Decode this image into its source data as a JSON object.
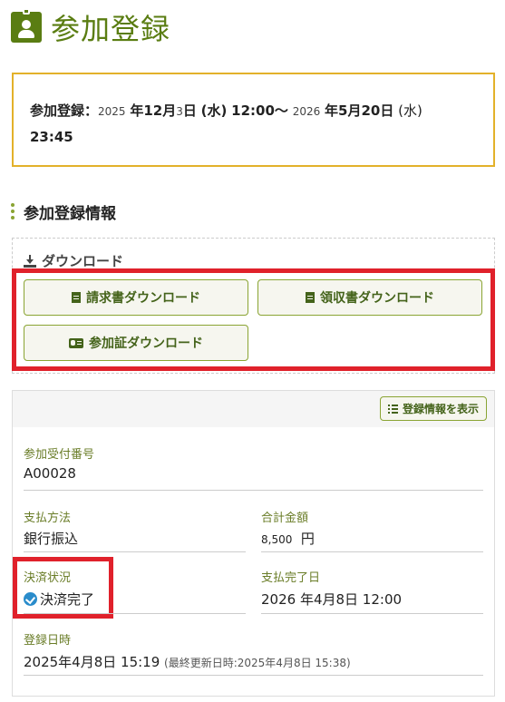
{
  "header": {
    "title": "参加登録",
    "icon": "id-badge-icon",
    "accent": "#5a7d12"
  },
  "period": {
    "label": "参加登録：",
    "start_year": "2025",
    "start_date": "年12月",
    "start_day": "3",
    "start_day_suffix": "日",
    "start_weekday": "(水)",
    "start_time": "12:00〜",
    "end_year": "2026",
    "end_date": "年5月20日",
    "end_weekday": "(水)",
    "end_time": "23:45",
    "border_color": "#e3b12a"
  },
  "section": {
    "title": "参加登録情報"
  },
  "download": {
    "heading": "ダウンロード",
    "buttons": {
      "invoice": "請求書ダウンロード",
      "receipt": "領収書ダウンロード",
      "certificate": "参加証ダウンロード"
    }
  },
  "info": {
    "show_button": "登録情報を表示",
    "receipt_no_label": "参加受付番号",
    "receipt_no": "A00028",
    "payment_method_label": "支払方法",
    "payment_method": "銀行振込",
    "total_label": "合計金額",
    "total_amount": "8,500",
    "total_unit": "円",
    "status_label": "決済状況",
    "status": "決済完了",
    "paid_at_label": "支払完了日",
    "paid_at": "2026 年4月8日 12:00",
    "registered_label": "登録日時",
    "registered_at": "2025年4月8日 15:19",
    "last_updated": "(最終更新日時:2025年4月8日 15:38)"
  },
  "colors": {
    "highlight": "#e0212b",
    "button_text": "#44631a",
    "label": "#6a7d28"
  }
}
